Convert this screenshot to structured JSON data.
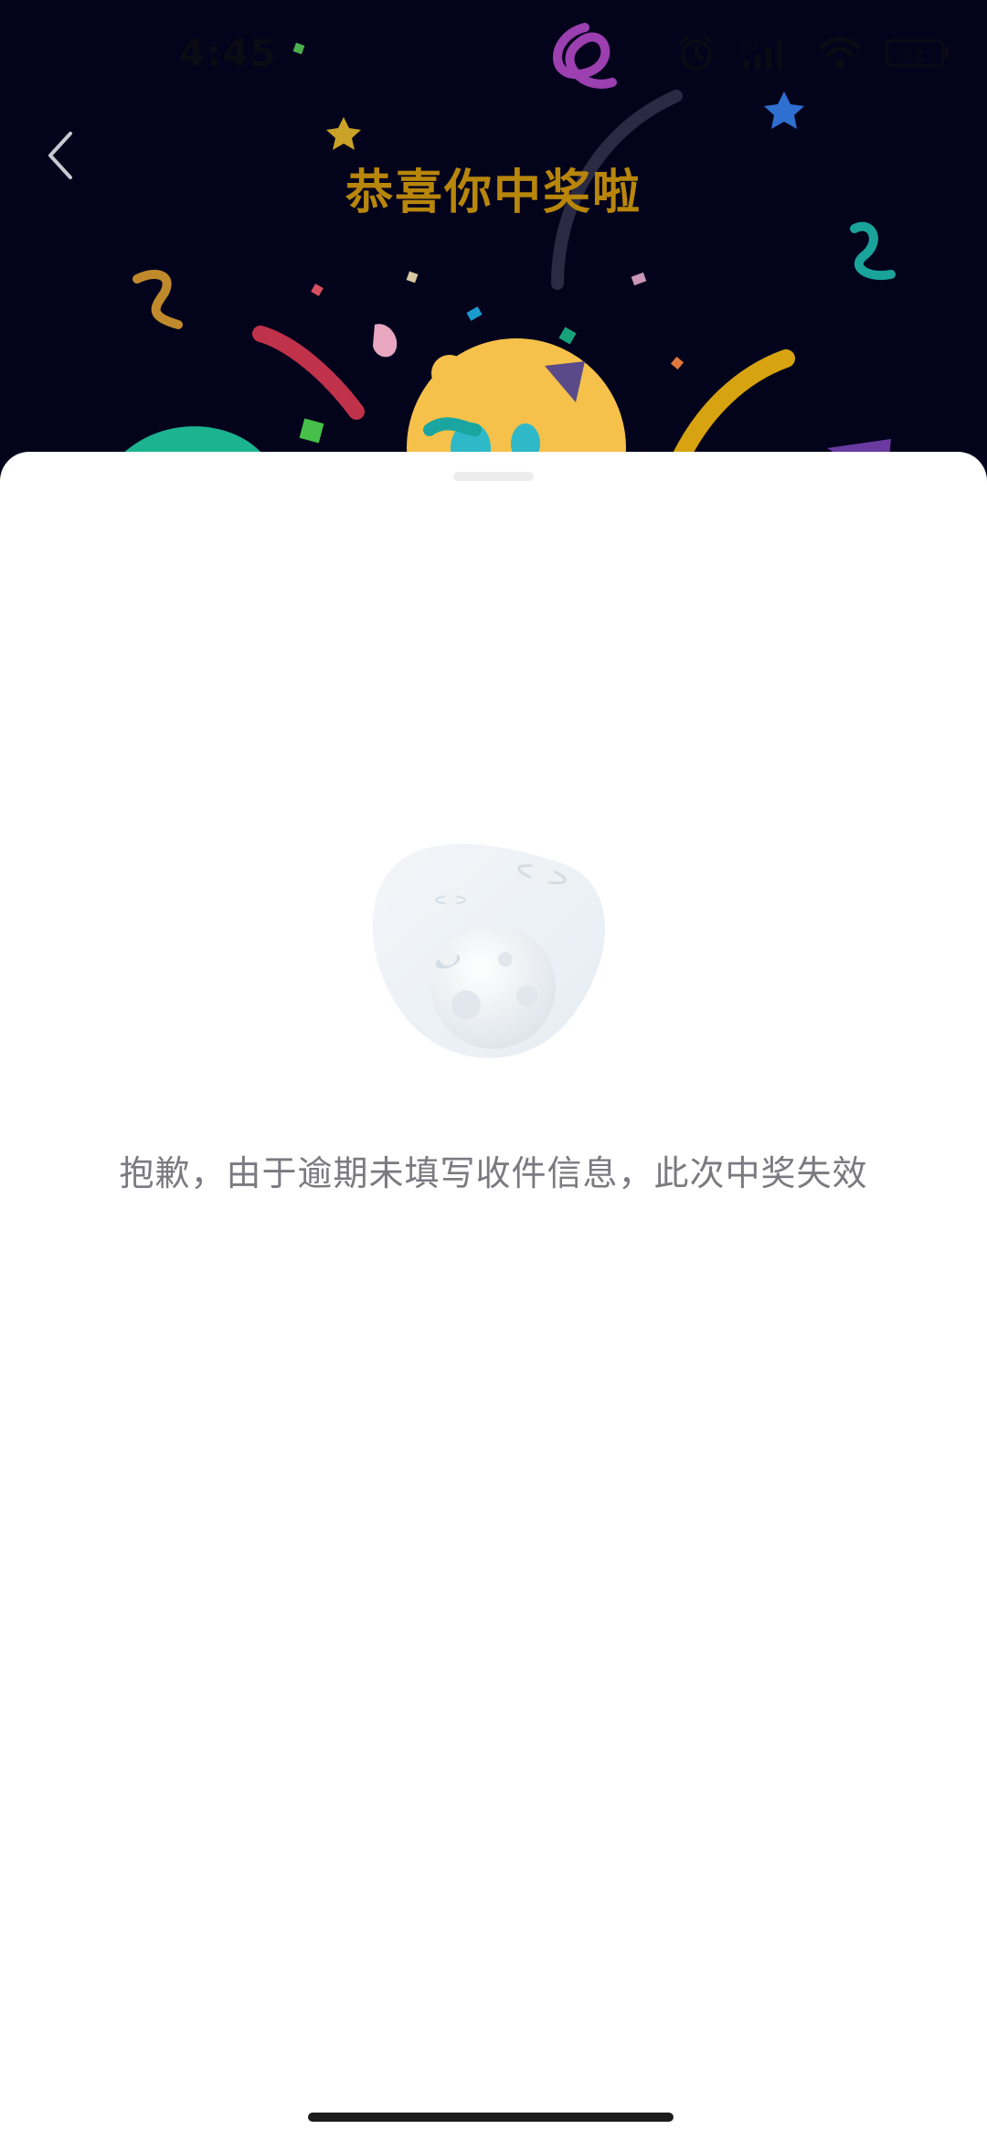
{
  "status_bar": {
    "time": "4:45",
    "icons": [
      "alarm-icon",
      "signal-icon",
      "wifi-icon",
      "battery-icon"
    ]
  },
  "header": {
    "title": "恭喜你中奖啦",
    "back_icon": "chevron-left-icon",
    "background_color": "#03031c",
    "title_color": "#b8860b"
  },
  "sheet": {
    "illustration": "moon-planet-empty-icon",
    "message": "抱歉，由于逾期未填写收件信息，此次中奖失效"
  }
}
